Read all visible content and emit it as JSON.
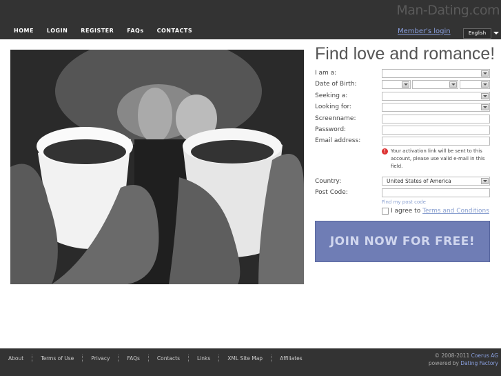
{
  "brand": "Man-Dating.com",
  "nav": {
    "home": "HOME",
    "login": "LOGIN",
    "register": "REGISTER",
    "faqs": "FAQs",
    "contacts": "CONTACTS"
  },
  "member_login": "Member's login",
  "language": "English",
  "heading": "Find love and romance!",
  "form": {
    "i_am_label": "I am a:",
    "dob_label": "Date of Birth:",
    "seeking_label": "Seeking a:",
    "looking_for_label": "Looking for:",
    "screenname_label": "Screenname:",
    "password_label": "Password:",
    "email_label": "Email address:",
    "email_note": "Your activation link will be sent to this account, please use valid e-mail in this field.",
    "country_label": "Country:",
    "country_value": "United States of America",
    "postcode_label": "Post Code:",
    "find_postcode": "Find my post code",
    "agree_prefix": "I agree to",
    "terms_link": "Terms and Conditions",
    "join_button": "JOIN NOW FOR FREE!"
  },
  "footer": {
    "links": [
      "About",
      "Terms of Use",
      "Privacy",
      "FAQs",
      "Contacts",
      "Links",
      "XML Site Map",
      "Affiliates"
    ],
    "copyright_prefix": "© 2008-2011",
    "copyright_company": "Coerus AG",
    "powered_prefix": "powered by",
    "powered_link": "Dating Factory"
  }
}
